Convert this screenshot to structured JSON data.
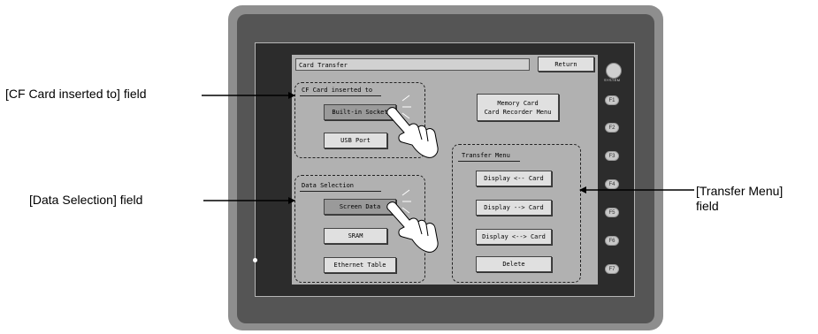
{
  "device": {
    "system_label": "SYSTEM",
    "function_keys": [
      "F1",
      "F2",
      "F3",
      "F4",
      "F5",
      "F6",
      "F7"
    ]
  },
  "screen": {
    "title": "Card Transfer",
    "return_label": "Return",
    "cf_group": {
      "label": "CF Card inserted to",
      "builtin_label": "Built-in Socket",
      "usb_label": "USB Port"
    },
    "memory_card_label": "Memory Card\nCard Recorder Menu",
    "data_group": {
      "label": "Data Selection",
      "screen_data_label": "Screen Data",
      "sram_label": "SRAM",
      "ethernet_label": "Ethernet Table"
    },
    "transfer_group": {
      "label": "Transfer Menu",
      "display_from_card": "Display <-- Card",
      "display_to_card": "Display --> Card",
      "display_both_card": "Display <--> Card",
      "delete_label": "Delete"
    }
  },
  "callouts": {
    "cf_field": "[CF Card inserted to] field",
    "data_field": "[Data Selection] field",
    "transfer_field_line1": "[Transfer Menu]",
    "transfer_field_line2": "field"
  }
}
